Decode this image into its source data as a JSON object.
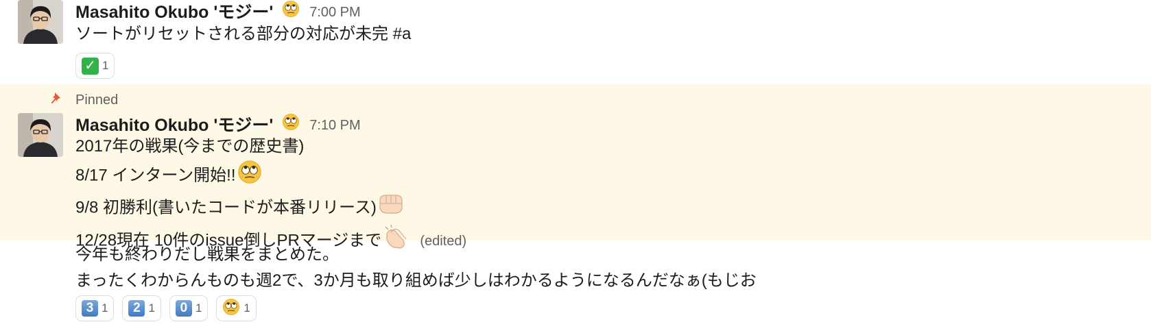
{
  "message1": {
    "sender": "Masahito Okubo 'モジー'",
    "status_emoji": "eye-roll-face-icon",
    "time": "7:00 PM",
    "text": "ソートがリセットされる部分の対応が未完 #a",
    "reactions": [
      {
        "emoji": "white-check-mark-icon",
        "count": "1"
      }
    ]
  },
  "message2": {
    "pinned_label": "Pinned",
    "sender": "Masahito Okubo 'モジー'",
    "status_emoji": "eye-roll-face-icon",
    "time": "7:10 PM",
    "lines": [
      {
        "text": "2017年の戦果(今までの歴史書)"
      },
      {
        "text": "8/17 インターン開始!!",
        "emoji": "eye-roll-face-icon"
      },
      {
        "text": "9/8 初勝利(書いたコードが本番リリース)",
        "emoji": "fist-bump-icon"
      },
      {
        "text": "12/28現在 10件のissue倒しPRマージまで",
        "emoji": "clapping-hands-icon"
      }
    ],
    "edited": "(edited)"
  },
  "message3": {
    "lines": [
      "今年も終わりだし戦果をまとめた。",
      "まったくわからんものも週2で、3か月も取り組めば少しはわかるようになるんだなぁ(もじお"
    ],
    "reactions": [
      {
        "emoji": "keycap-3-icon",
        "glyph": "3",
        "count": "1"
      },
      {
        "emoji": "keycap-2-icon",
        "glyph": "2",
        "count": "1"
      },
      {
        "emoji": "keycap-0-icon",
        "glyph": "0",
        "count": "1"
      },
      {
        "emoji": "eye-roll-face-icon",
        "count": "1"
      }
    ]
  },
  "colors": {
    "pinned_background": "#fef9e6",
    "pin_icon": "#e05c3a",
    "timestamp": "#616061"
  }
}
